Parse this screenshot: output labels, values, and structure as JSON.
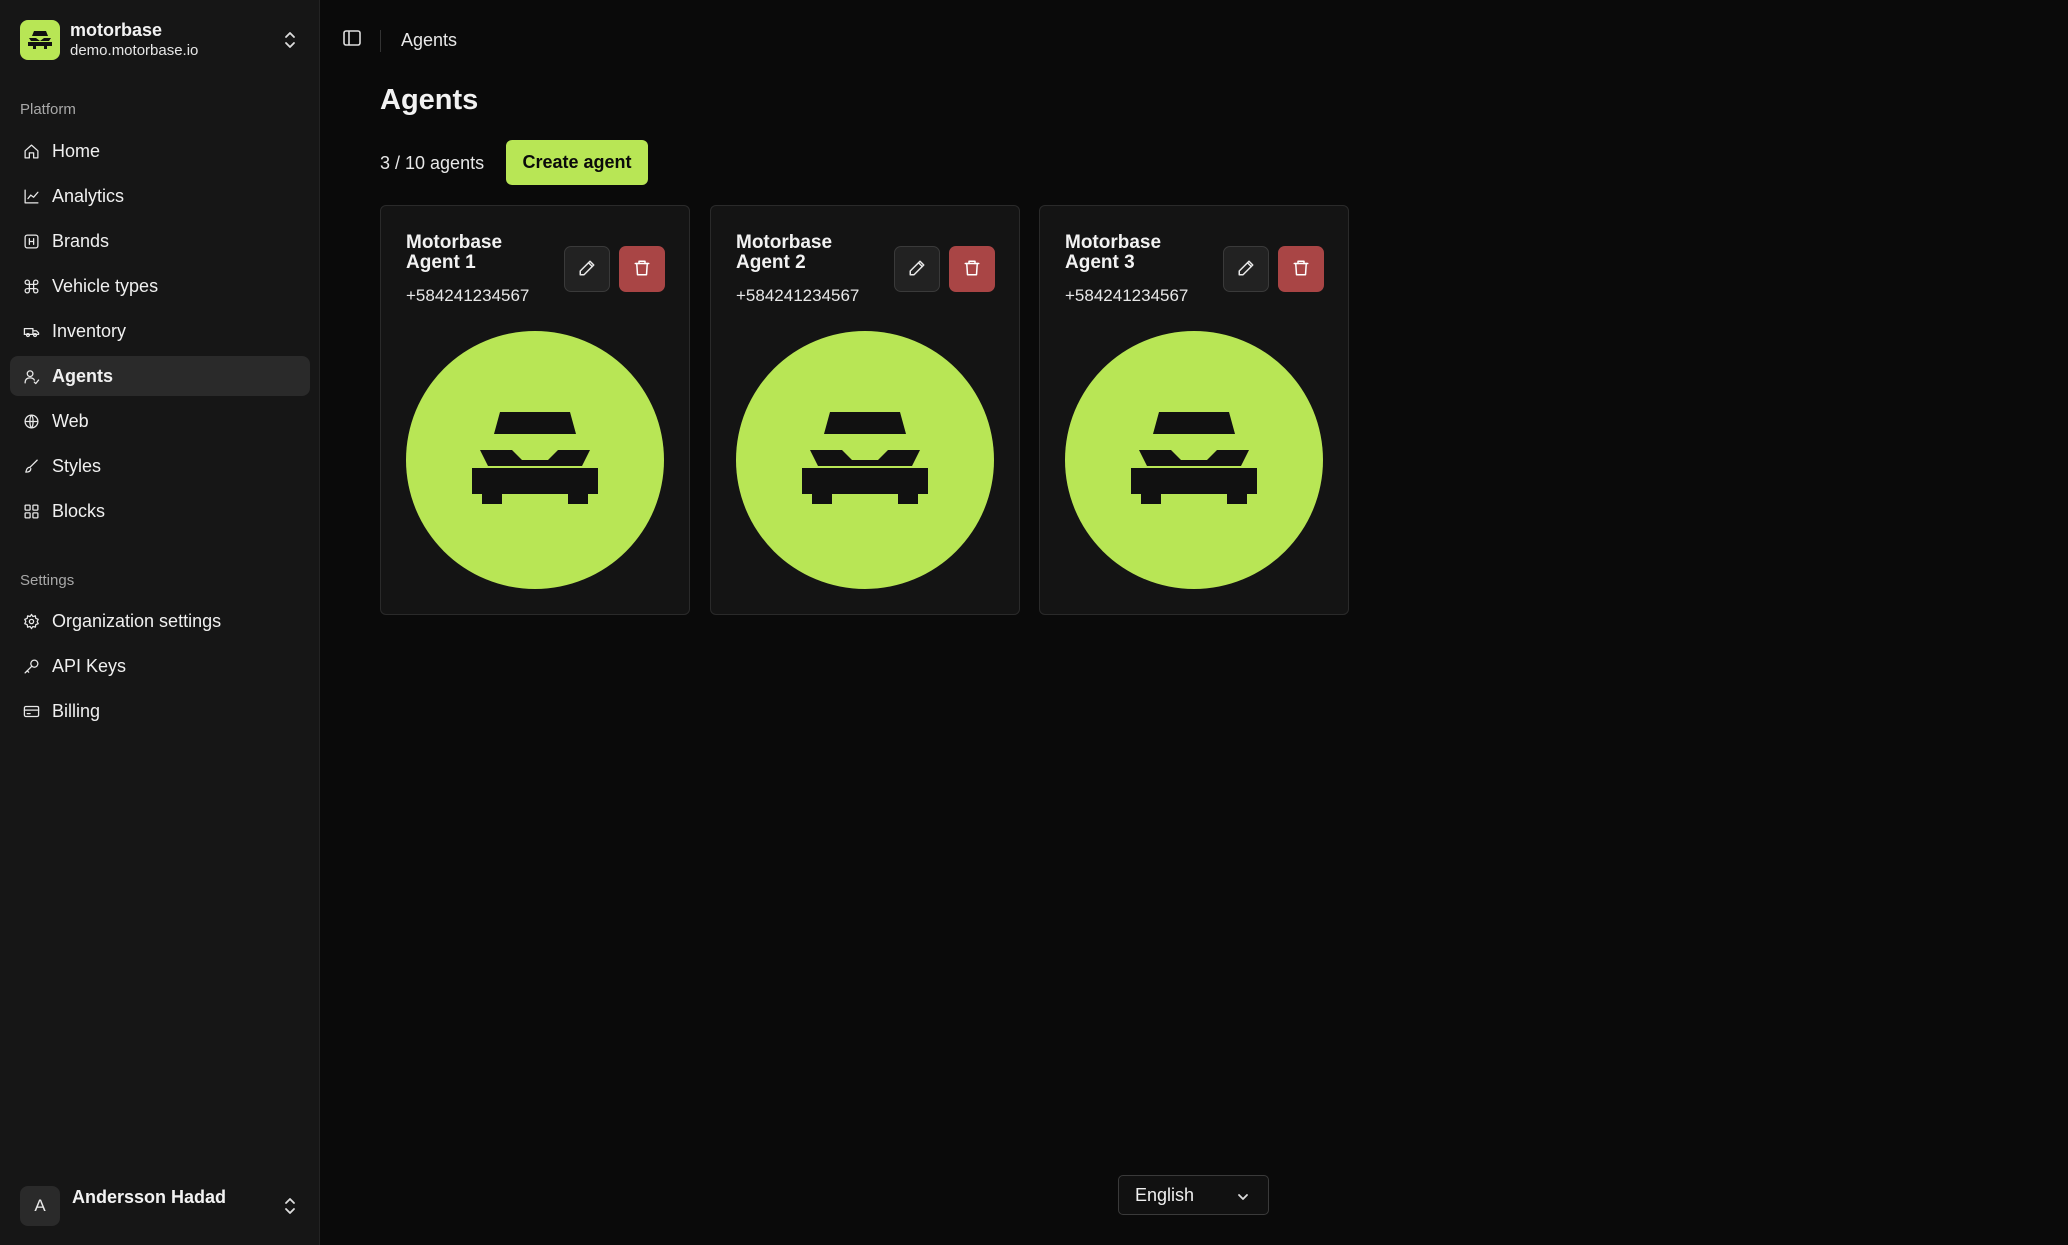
{
  "org": {
    "name": "motorbase",
    "domain": "demo.motorbase.io"
  },
  "sidebar": {
    "platform_label": "Platform",
    "platform_items": [
      {
        "label": "Home",
        "icon": "home-icon"
      },
      {
        "label": "Analytics",
        "icon": "chart-line-icon"
      },
      {
        "label": "Brands",
        "icon": "brand-icon"
      },
      {
        "label": "Vehicle types",
        "icon": "command-icon"
      },
      {
        "label": "Inventory",
        "icon": "truck-icon"
      },
      {
        "label": "Agents",
        "icon": "user-icon",
        "active": true
      },
      {
        "label": "Web",
        "icon": "globe-icon"
      },
      {
        "label": "Styles",
        "icon": "brush-icon"
      },
      {
        "label": "Blocks",
        "icon": "blocks-icon"
      }
    ],
    "settings_label": "Settings",
    "settings_items": [
      {
        "label": "Organization settings",
        "icon": "gear-icon"
      },
      {
        "label": "API Keys",
        "icon": "key-icon"
      },
      {
        "label": "Billing",
        "icon": "credit-card-icon"
      }
    ]
  },
  "user": {
    "initial": "A",
    "name": "Andersson Hadad"
  },
  "header": {
    "breadcrumb": "Agents"
  },
  "main": {
    "title": "Agents",
    "count": "3 / 10 agents",
    "create_label": "Create agent",
    "agents": [
      {
        "name": "Motorbase Agent 1",
        "phone": "+584241234567"
      },
      {
        "name": "Motorbase Agent 2",
        "phone": "+584241234567"
      },
      {
        "name": "Motorbase Agent 3",
        "phone": "+584241234567"
      }
    ]
  },
  "language": {
    "selected": "English"
  },
  "colors": {
    "accent": "#b8e655",
    "danger": "#a94545",
    "background": "#0a0a0a",
    "sidebar": "#161616"
  }
}
